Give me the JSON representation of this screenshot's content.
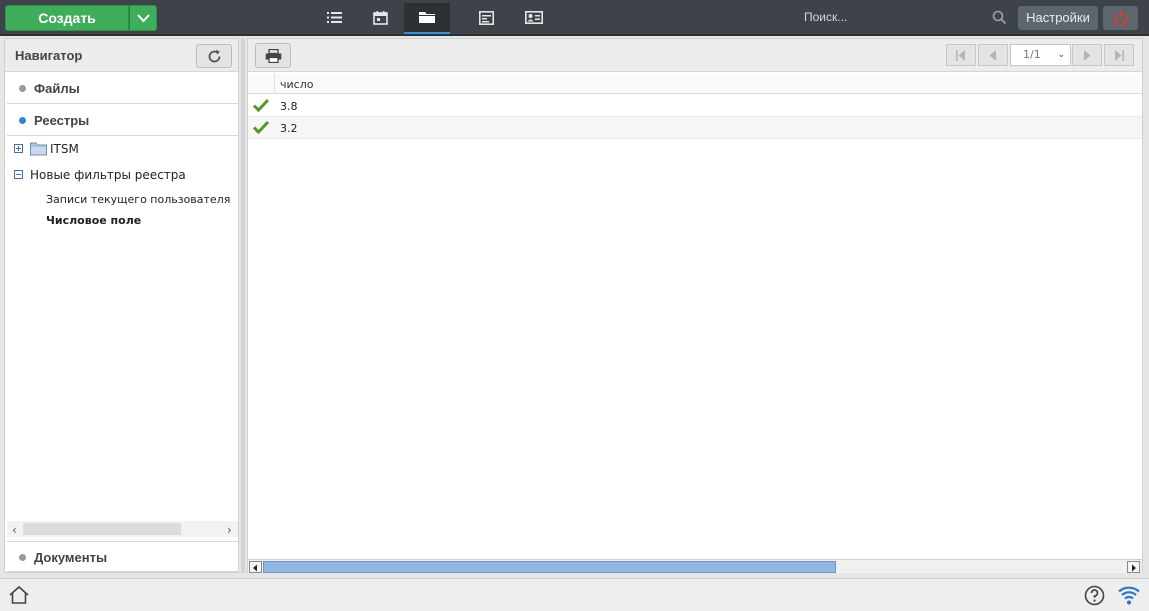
{
  "topbar": {
    "create_label": "Создать",
    "search_placeholder": "Поиск...",
    "settings_label": "Настройки",
    "accent_color": "#3fae5a",
    "power_color": "#e03a2f",
    "nav_icons": [
      "list-icon",
      "calendar-icon",
      "folder-icon",
      "news-icon",
      "contact-card-icon"
    ],
    "active_nav": "folder-icon"
  },
  "navigator": {
    "title": "Навигатор",
    "sections": {
      "files": "Файлы",
      "registries": "Реестры",
      "documents": "Документы"
    },
    "tree": {
      "itsm": "ITSM",
      "new_filters": "Новые фильтры реестра",
      "filters": [
        {
          "label": "Записи текущего пользователя",
          "selected": false
        },
        {
          "label": "Числовое поле",
          "selected": true
        }
      ]
    }
  },
  "grid": {
    "pager": {
      "current": "1/1"
    },
    "column": "число",
    "rows": [
      {
        "checked": true,
        "value": "3.8"
      },
      {
        "checked": true,
        "value": "3.2"
      }
    ]
  }
}
